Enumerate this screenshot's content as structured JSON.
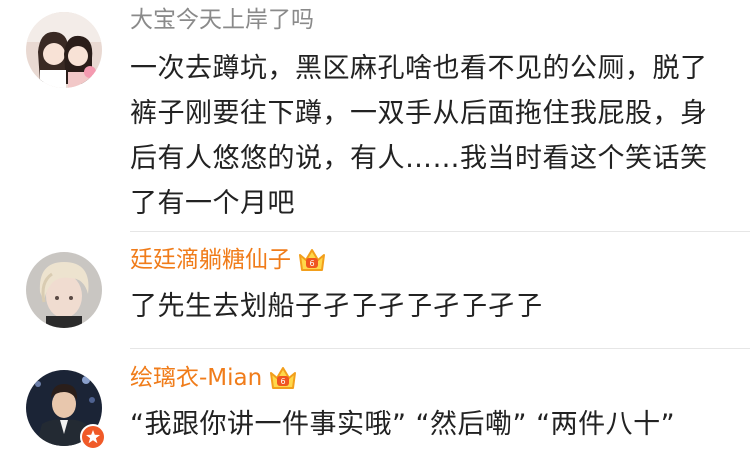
{
  "comments": [
    {
      "username": "大宝今天上岸了吗",
      "text": "一次去蹲坑，黑区麻孔啥也看不见的公厕，脱了裤子刚要往下蹲，一双手从后面拖住我屁股，身后有人悠悠的说，有人……我当时看这个笑话笑了有一个月吧",
      "avatar_icon": "avatar-two-girls",
      "name_color": "#8a8a8a"
    },
    {
      "username": "廷廷滴躺糖仙子",
      "text": "了先生去划船子孑孒孑孒孑孒孑孒",
      "avatar_icon": "avatar-blond-boy",
      "name_color": "#f07c1a",
      "badge_icon": "crown-vip-icon"
    },
    {
      "username": "绘璃衣-Mian",
      "text": "“我跟你讲一件事实哦” “然后嘞” “两件八十”",
      "avatar_icon": "avatar-suit-man",
      "name_color": "#f07c1a",
      "badge_icon": "crown-vip-icon",
      "verified_icon": "verified-star-icon"
    }
  ]
}
